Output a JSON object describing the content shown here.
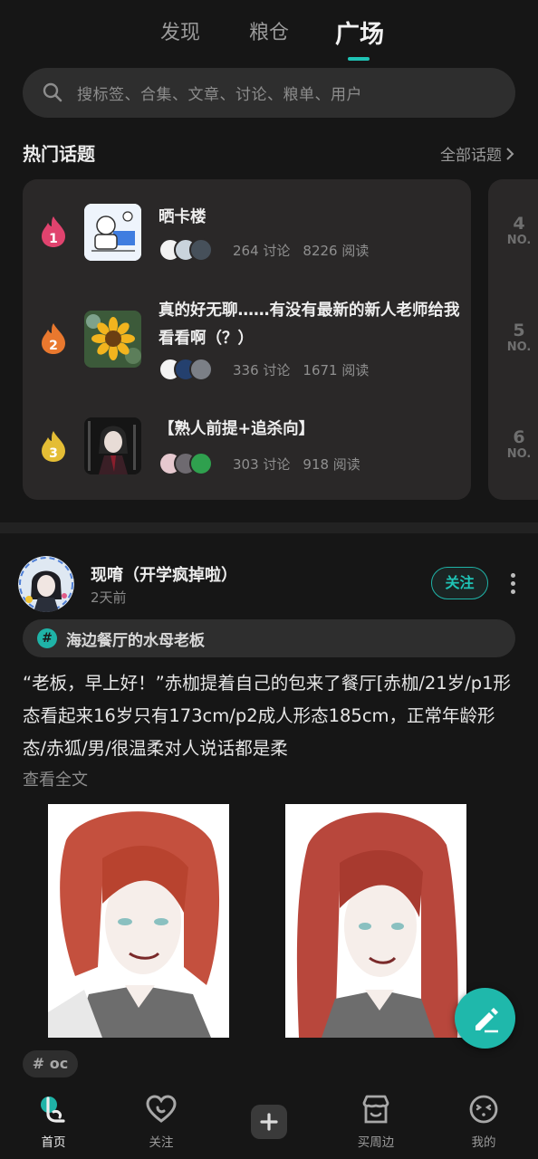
{
  "tabs": [
    {
      "label": "发现"
    },
    {
      "label": "粮仓"
    },
    {
      "label": "广场",
      "active": true
    }
  ],
  "search": {
    "placeholder": "搜标签、合集、文章、讨论、粮单、用户"
  },
  "hot_topics": {
    "title": "热门话题",
    "all_link": "全部话题",
    "items": [
      {
        "rank": "1",
        "title": "晒卡楼",
        "discussions": "264 讨论",
        "reads": "8226 阅读",
        "rank_color": "#e0436e"
      },
      {
        "rank": "2",
        "title": "真的好无聊……有没有最新的新人老师给我看看啊（？）",
        "discussions": "336 讨论",
        "reads": "1671 阅读",
        "rank_color": "#e9782e"
      },
      {
        "rank": "3",
        "title": "【熟人前提+追杀向】",
        "discussions": "303 讨论",
        "reads": "918 阅读",
        "rank_color": "#e4bd35"
      }
    ],
    "side_ranks": [
      {
        "n": "4",
        "no": "NO."
      },
      {
        "n": "5",
        "no": "NO."
      },
      {
        "n": "6",
        "no": "NO."
      }
    ]
  },
  "post": {
    "username": "现唷（开学疯掉啦）",
    "time": "2天前",
    "follow_label": "关注",
    "tag": "海边餐厅的水母老板",
    "tag_hash": "#",
    "body": "“老板，早上好！”赤枷提着自己的包来了餐厅[赤枷/21岁/p1形态看起来16岁只有173cm/p2成人形态185cm，正常年龄形态/赤狐/男/很温柔对人说话都是柔",
    "read_more": "查看全文",
    "footer_tag": "# oc"
  },
  "bottom_nav": [
    {
      "label": "首页",
      "icon": "home-icon",
      "active": true
    },
    {
      "label": "关注",
      "icon": "heart-icon"
    },
    {
      "label": "",
      "icon": "plus-icon"
    },
    {
      "label": "买周边",
      "icon": "shop-icon"
    },
    {
      "label": "我的",
      "icon": "profile-icon"
    }
  ],
  "colors": {
    "accent": "#1fc3b5",
    "background": "#161616",
    "card": "#2a2828"
  }
}
